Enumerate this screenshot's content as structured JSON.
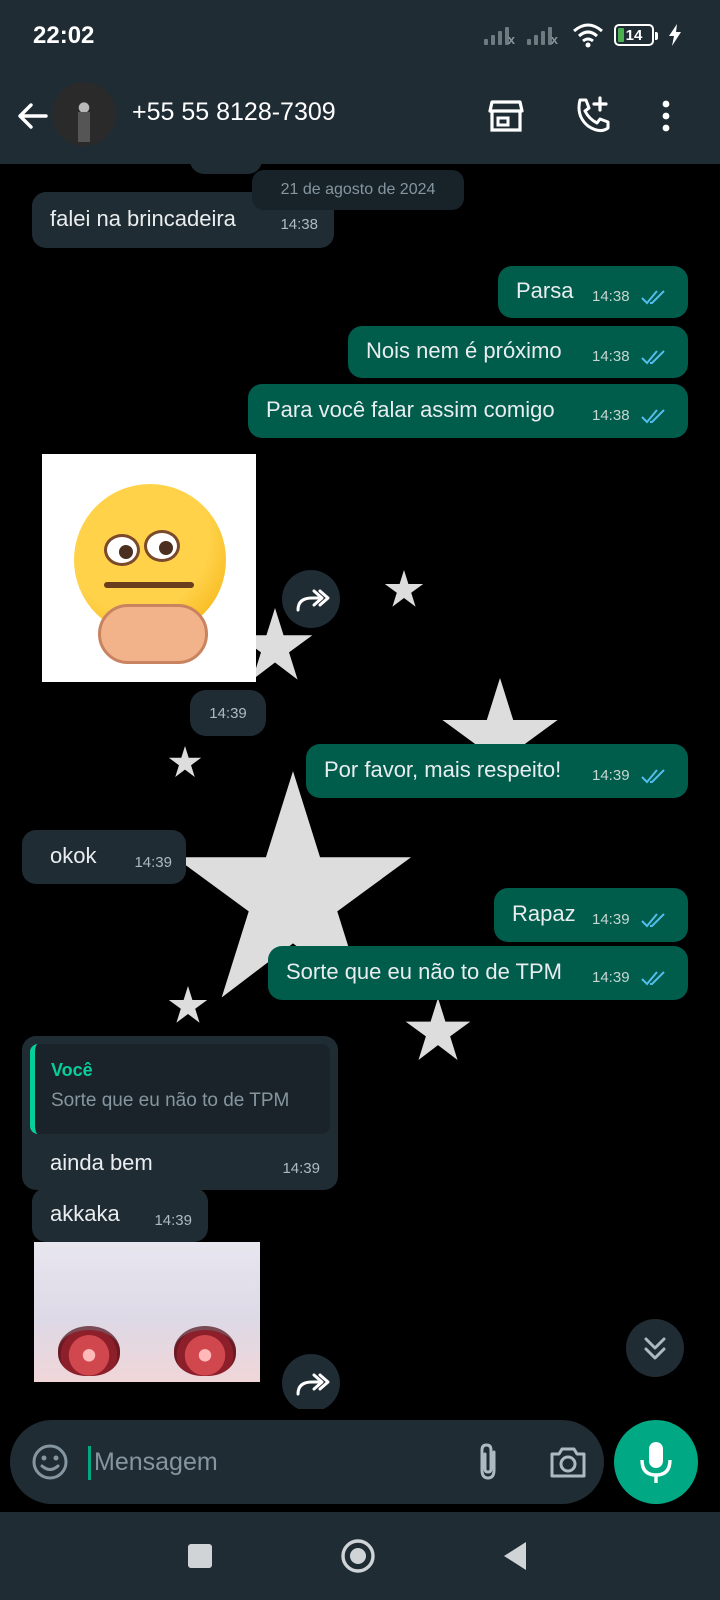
{
  "status_bar": {
    "time": "22:02",
    "battery": "14"
  },
  "header": {
    "contact": "+55 55 8128-7309"
  },
  "date_separator": "21 de agosto de 2024",
  "messages": [
    {
      "text": "falei na brincadeira",
      "time": "14:38"
    },
    {
      "text": "Parsa",
      "time": "14:38"
    },
    {
      "text": "Nois nem é próximo",
      "time": "14:38"
    },
    {
      "text": "Para você falar assim comigo",
      "time": "14:38"
    },
    {
      "time": "14:39"
    },
    {
      "text": "Por favor, mais respeito!",
      "time": "14:39"
    },
    {
      "text": "okok",
      "time": "14:39"
    },
    {
      "text": "Rapaz",
      "time": "14:39"
    },
    {
      "text": "Sorte que eu não to de TPM",
      "time": "14:39"
    },
    {
      "quote_author": "Você",
      "quote_text": "Sorte que eu não to de TPM",
      "text": "ainda bem",
      "time": "14:39"
    },
    {
      "text": "akkaka",
      "time": "14:39"
    }
  ],
  "composer": {
    "placeholder": "Mensagem"
  },
  "colors": {
    "incoming": "#202c33",
    "outgoing": "#005c4b",
    "accent": "#00a884",
    "read_ticks": "#53bdeb"
  }
}
